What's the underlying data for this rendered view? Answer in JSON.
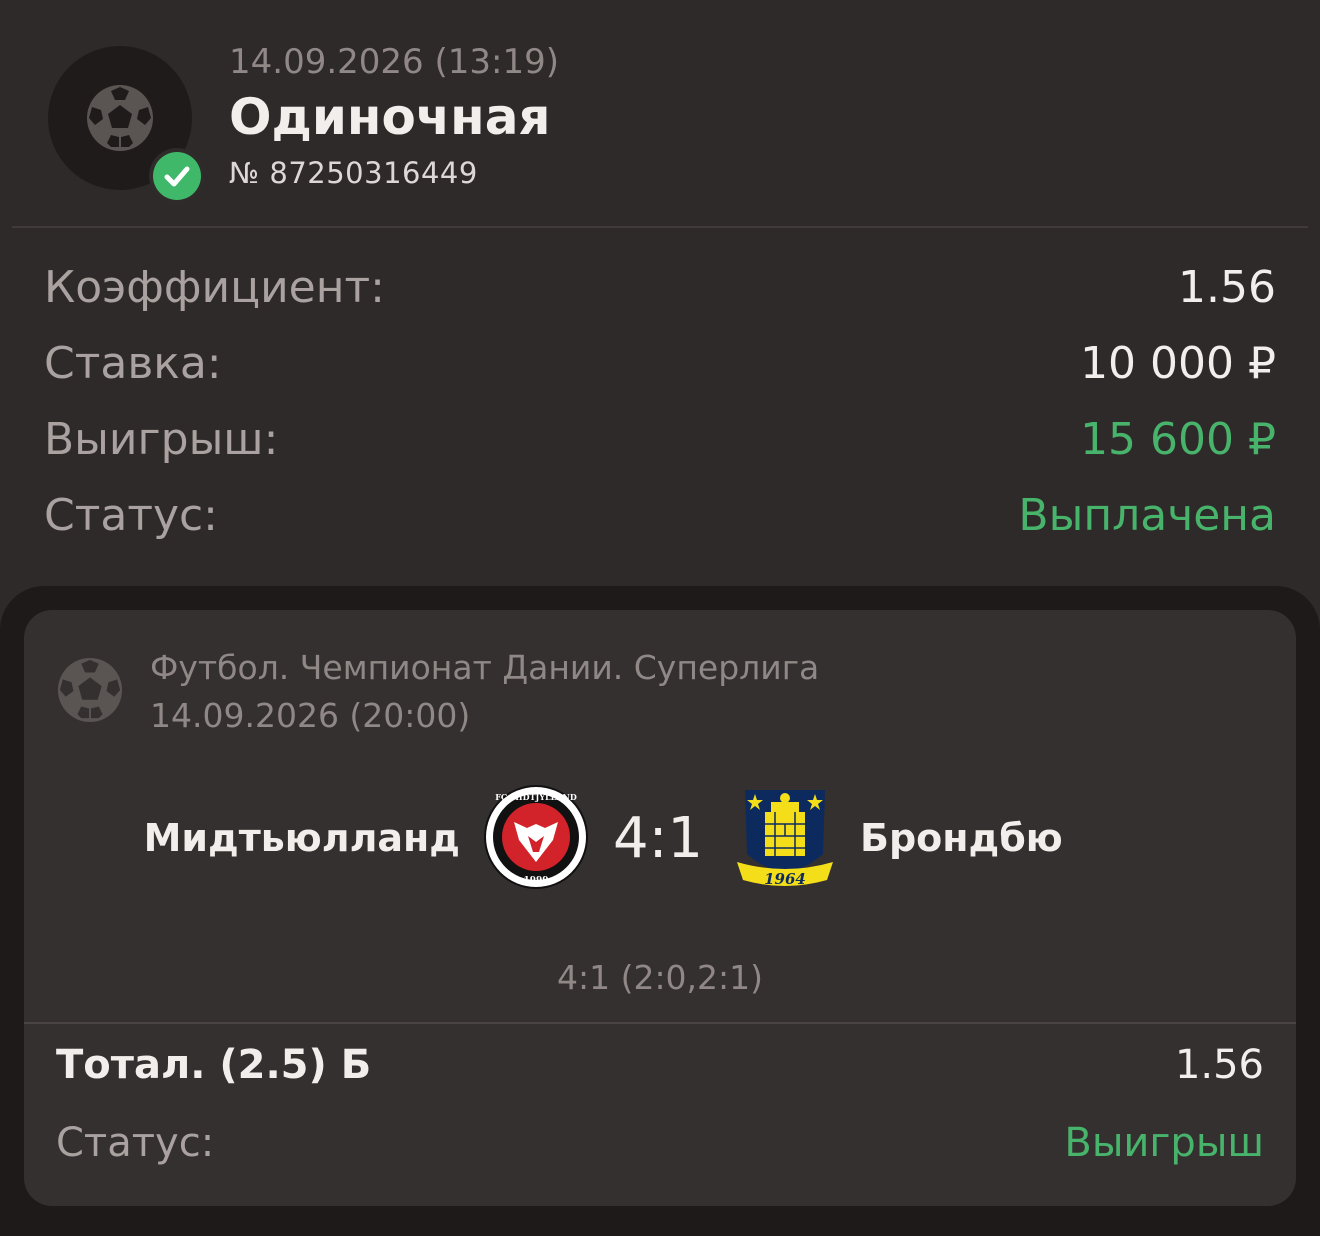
{
  "bet": {
    "datetime": "14.09.2026 (13:19)",
    "type": "Одиночная",
    "number": "№ 87250316449",
    "status_icon": "check-icon"
  },
  "summary": {
    "coefficient_label": "Коэффициент:",
    "coefficient_value": "1.56",
    "stake_label": "Ставка:",
    "stake_value": "10 000 ₽",
    "win_label": "Выигрыш:",
    "win_value": "15 600 ₽",
    "status_label": "Статус:",
    "status_value": "Выплачена"
  },
  "event": {
    "league": "Футбол. Чемпионат Дании. Суперлига",
    "datetime": "14.09.2026 (20:00)",
    "home_team": "Мидтьюлланд",
    "away_team": "Брондбю",
    "home_logo_text": "FC MIDTJYLLAND",
    "home_logo_year": "1999",
    "away_logo_year": "1964",
    "score": "4:1",
    "score_detail": "4:1 (2:0,2:1)"
  },
  "outcome": {
    "name": "Тотал. (2.5) Б",
    "odd": "1.56",
    "status_label": "Статус:",
    "status_value": "Выигрыш"
  },
  "colors": {
    "background": "#2e2a29",
    "card": "#343030",
    "accent_green": "#48b36b",
    "badge_green": "#3fb86a"
  }
}
